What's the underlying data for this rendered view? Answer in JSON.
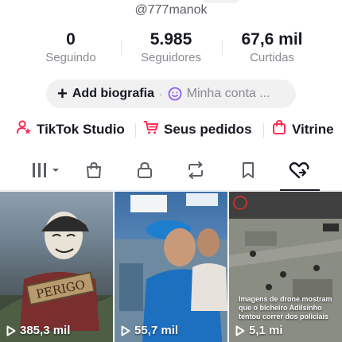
{
  "profile": {
    "username": "@777manok"
  },
  "stats": [
    {
      "value": "0",
      "label": "Seguindo"
    },
    {
      "value": "5.985",
      "label": "Seguidores"
    },
    {
      "value": "67,6 mil",
      "label": "Curtidas"
    }
  ],
  "bio": {
    "add_label": "Add biografia",
    "separator": "·",
    "account_label": "Minha conta ..."
  },
  "links": [
    {
      "label": "TikTok Studio",
      "icon": "person-star-icon"
    },
    {
      "label": "Seus pedidos",
      "icon": "cart-icon"
    },
    {
      "label": "Vitrine",
      "icon": "shopping-bag-icon"
    }
  ],
  "tabs": [
    {
      "icon": "grid-videos-icon",
      "selected": false
    },
    {
      "icon": "shop-bag-icon",
      "selected": false
    },
    {
      "icon": "lock-icon",
      "selected": false
    },
    {
      "icon": "repost-icon",
      "selected": false
    },
    {
      "icon": "bookmark-icon",
      "selected": false
    },
    {
      "icon": "liked-heart-icon",
      "selected": true
    }
  ],
  "videos": [
    {
      "views": "385,3 mil",
      "overlay_text": "PERIGO"
    },
    {
      "views": "55,7 mil",
      "overlay_text": ""
    },
    {
      "views": "5,1 mi",
      "overlay_text": "Imagens de drone mostram que o bicheiro Adilsinho tentou correr dos policiais"
    }
  ],
  "colors": {
    "accent_red": "#fe2c55",
    "text_primary": "#161823",
    "text_secondary": "#8a8b91",
    "pill_bg": "#f1f1f2",
    "smile_purple": "#8b5cf6"
  }
}
